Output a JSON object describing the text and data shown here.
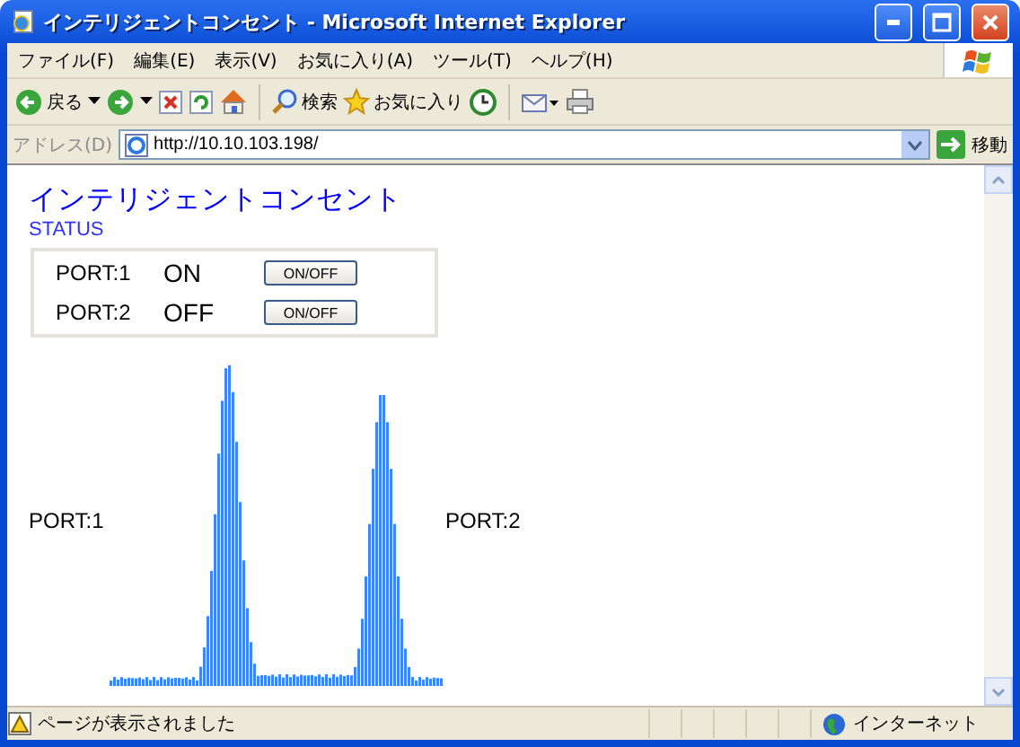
{
  "window": {
    "title": "インテリジェントコンセント - Microsoft Internet Explorer"
  },
  "menu": [
    "ファイル(F)",
    "編集(E)",
    "表示(V)",
    "お気に入り(A)",
    "ツール(T)",
    "ヘルプ(H)"
  ],
  "toolbar": {
    "back": "戻る",
    "search": "検索",
    "favorites": "お気に入り"
  },
  "address": {
    "label": "アドレス(D)",
    "url": "http://10.10.103.198/",
    "go": "移動"
  },
  "page": {
    "heading": "インテリジェントコンセント",
    "subheading": "STATUS",
    "ports": [
      {
        "name": "PORT:1",
        "state": "ON",
        "button": "ON/OFF"
      },
      {
        "name": "PORT:2",
        "state": "OFF",
        "button": "ON/OFF"
      }
    ],
    "graph_labels": [
      "PORT:1",
      "PORT:2"
    ]
  },
  "status_bar": {
    "message": "ページが表示されました",
    "zone": "インターネット"
  }
}
